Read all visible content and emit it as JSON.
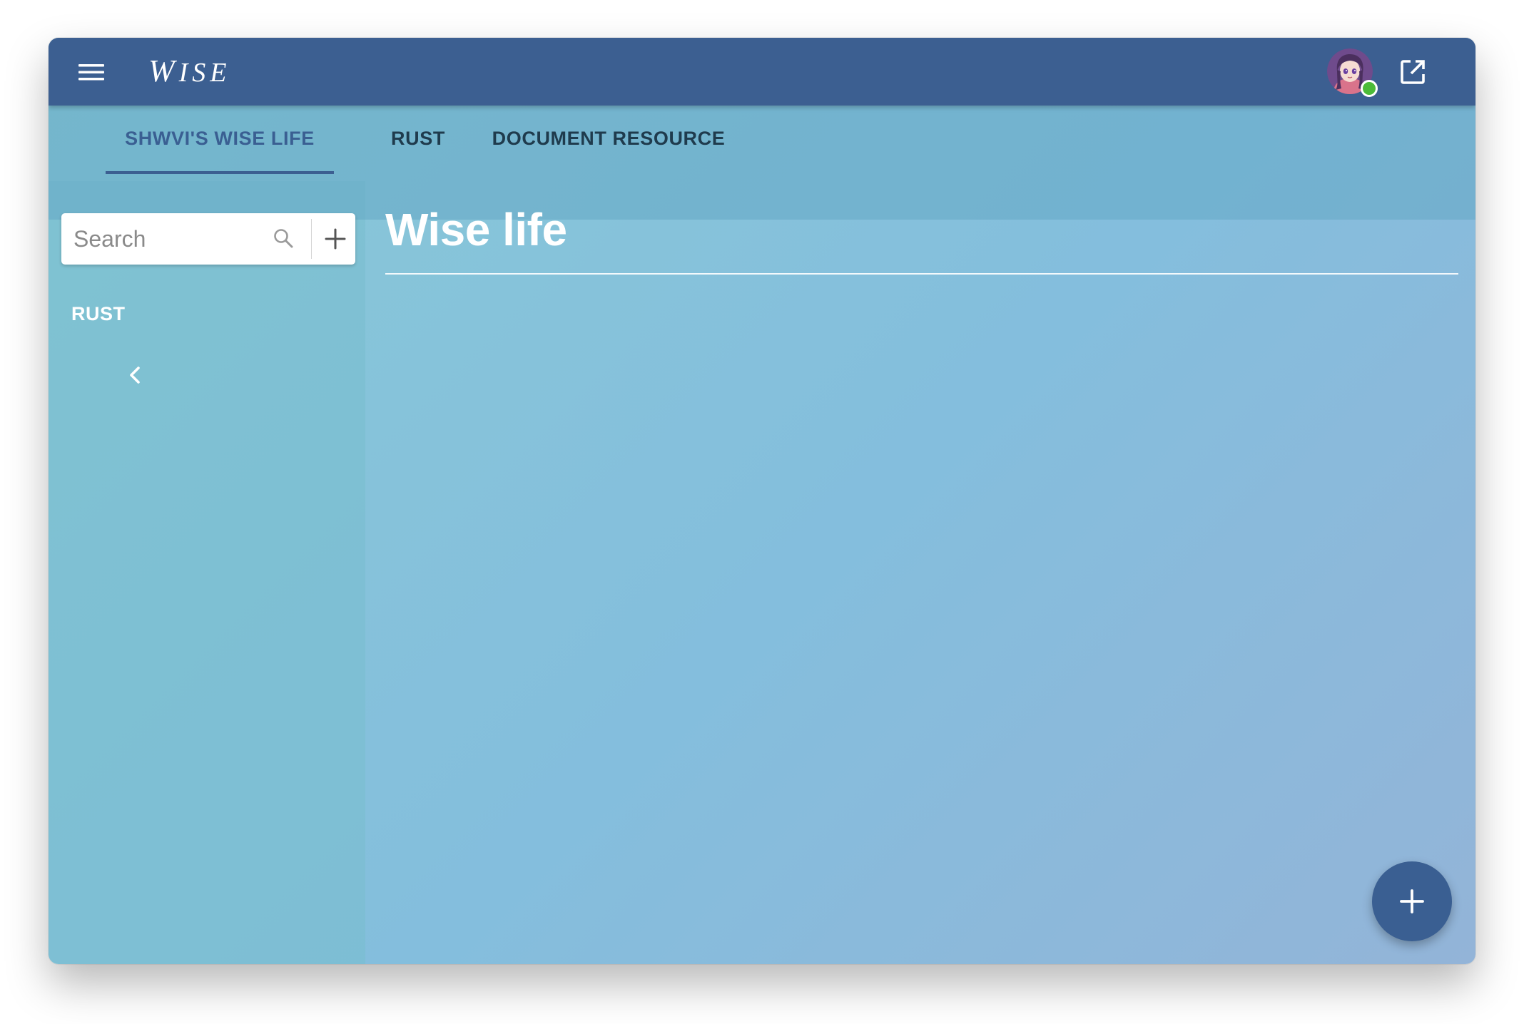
{
  "app": {
    "brand": "WISE",
    "menu_icon": "hamburger-menu-icon",
    "avatar_icon": "user-avatar",
    "open_icon": "open-in-new-icon",
    "status": "online",
    "colors": {
      "primary": "#3c5f91",
      "online": "#4cbb38",
      "accent_tab": "#3a5f92"
    }
  },
  "tabs": [
    {
      "label": "SHWVI'S WISE LIFE",
      "active": true
    },
    {
      "label": "RUST",
      "active": false
    },
    {
      "label": "DOCUMENT RESOURCE",
      "active": false
    }
  ],
  "sidebar": {
    "search": {
      "placeholder": "Search",
      "value": "",
      "icon": "search-icon"
    },
    "add_icon": "plus-icon",
    "section_label": "RUST",
    "collapse_icon": "chevron-left-icon"
  },
  "main": {
    "title": "Wise life",
    "fab_icon": "plus-icon"
  }
}
